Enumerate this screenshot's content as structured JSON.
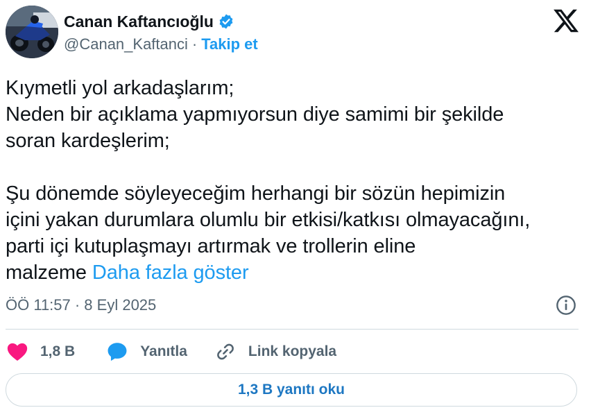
{
  "author": {
    "name": "Canan Kaftancıoğlu",
    "handle": "@Canan_Kaftanci",
    "separator": "·",
    "follow_label": "Takip et",
    "avatar_icon": "avatar-motorcycle-photo",
    "verified_icon": "verified-badge-icon"
  },
  "brand": {
    "logo_icon": "x-logo-icon",
    "color": "#0f1419"
  },
  "tweet": {
    "lines": [
      "Kıymetli yol arkadaşlarım;",
      "Neden bir açıklama yapmıyorsun diye samimi bir şekilde",
      "soran kardeşlerim;",
      "",
      "Şu dönemde söyleyeceğim herhangi bir sözün hepimizin",
      "içini yakan durumlara olumlu bir etkisi/katkısı olmayacağını,",
      "parti içi kutuplaşmayı artırmak ve trollerin eline"
    ],
    "last_line_text": "malzeme",
    "show_more_label": "Daha fazla göster"
  },
  "meta": {
    "timestamp": "ÖÖ 11:57 · 8 Eyl 2025",
    "info_icon": "info-icon"
  },
  "actions": {
    "like_count": "1,8 B",
    "reply_label": "Yanıtla",
    "copy_link_label": "Link kopyala"
  },
  "read_replies_label": "1,3 B yanıtı oku",
  "colors": {
    "accent": "#1d9bf0",
    "like": "#f91880",
    "verified": "#1d9bf0",
    "secondary_text": "#536471",
    "border": "#cfd9de"
  }
}
